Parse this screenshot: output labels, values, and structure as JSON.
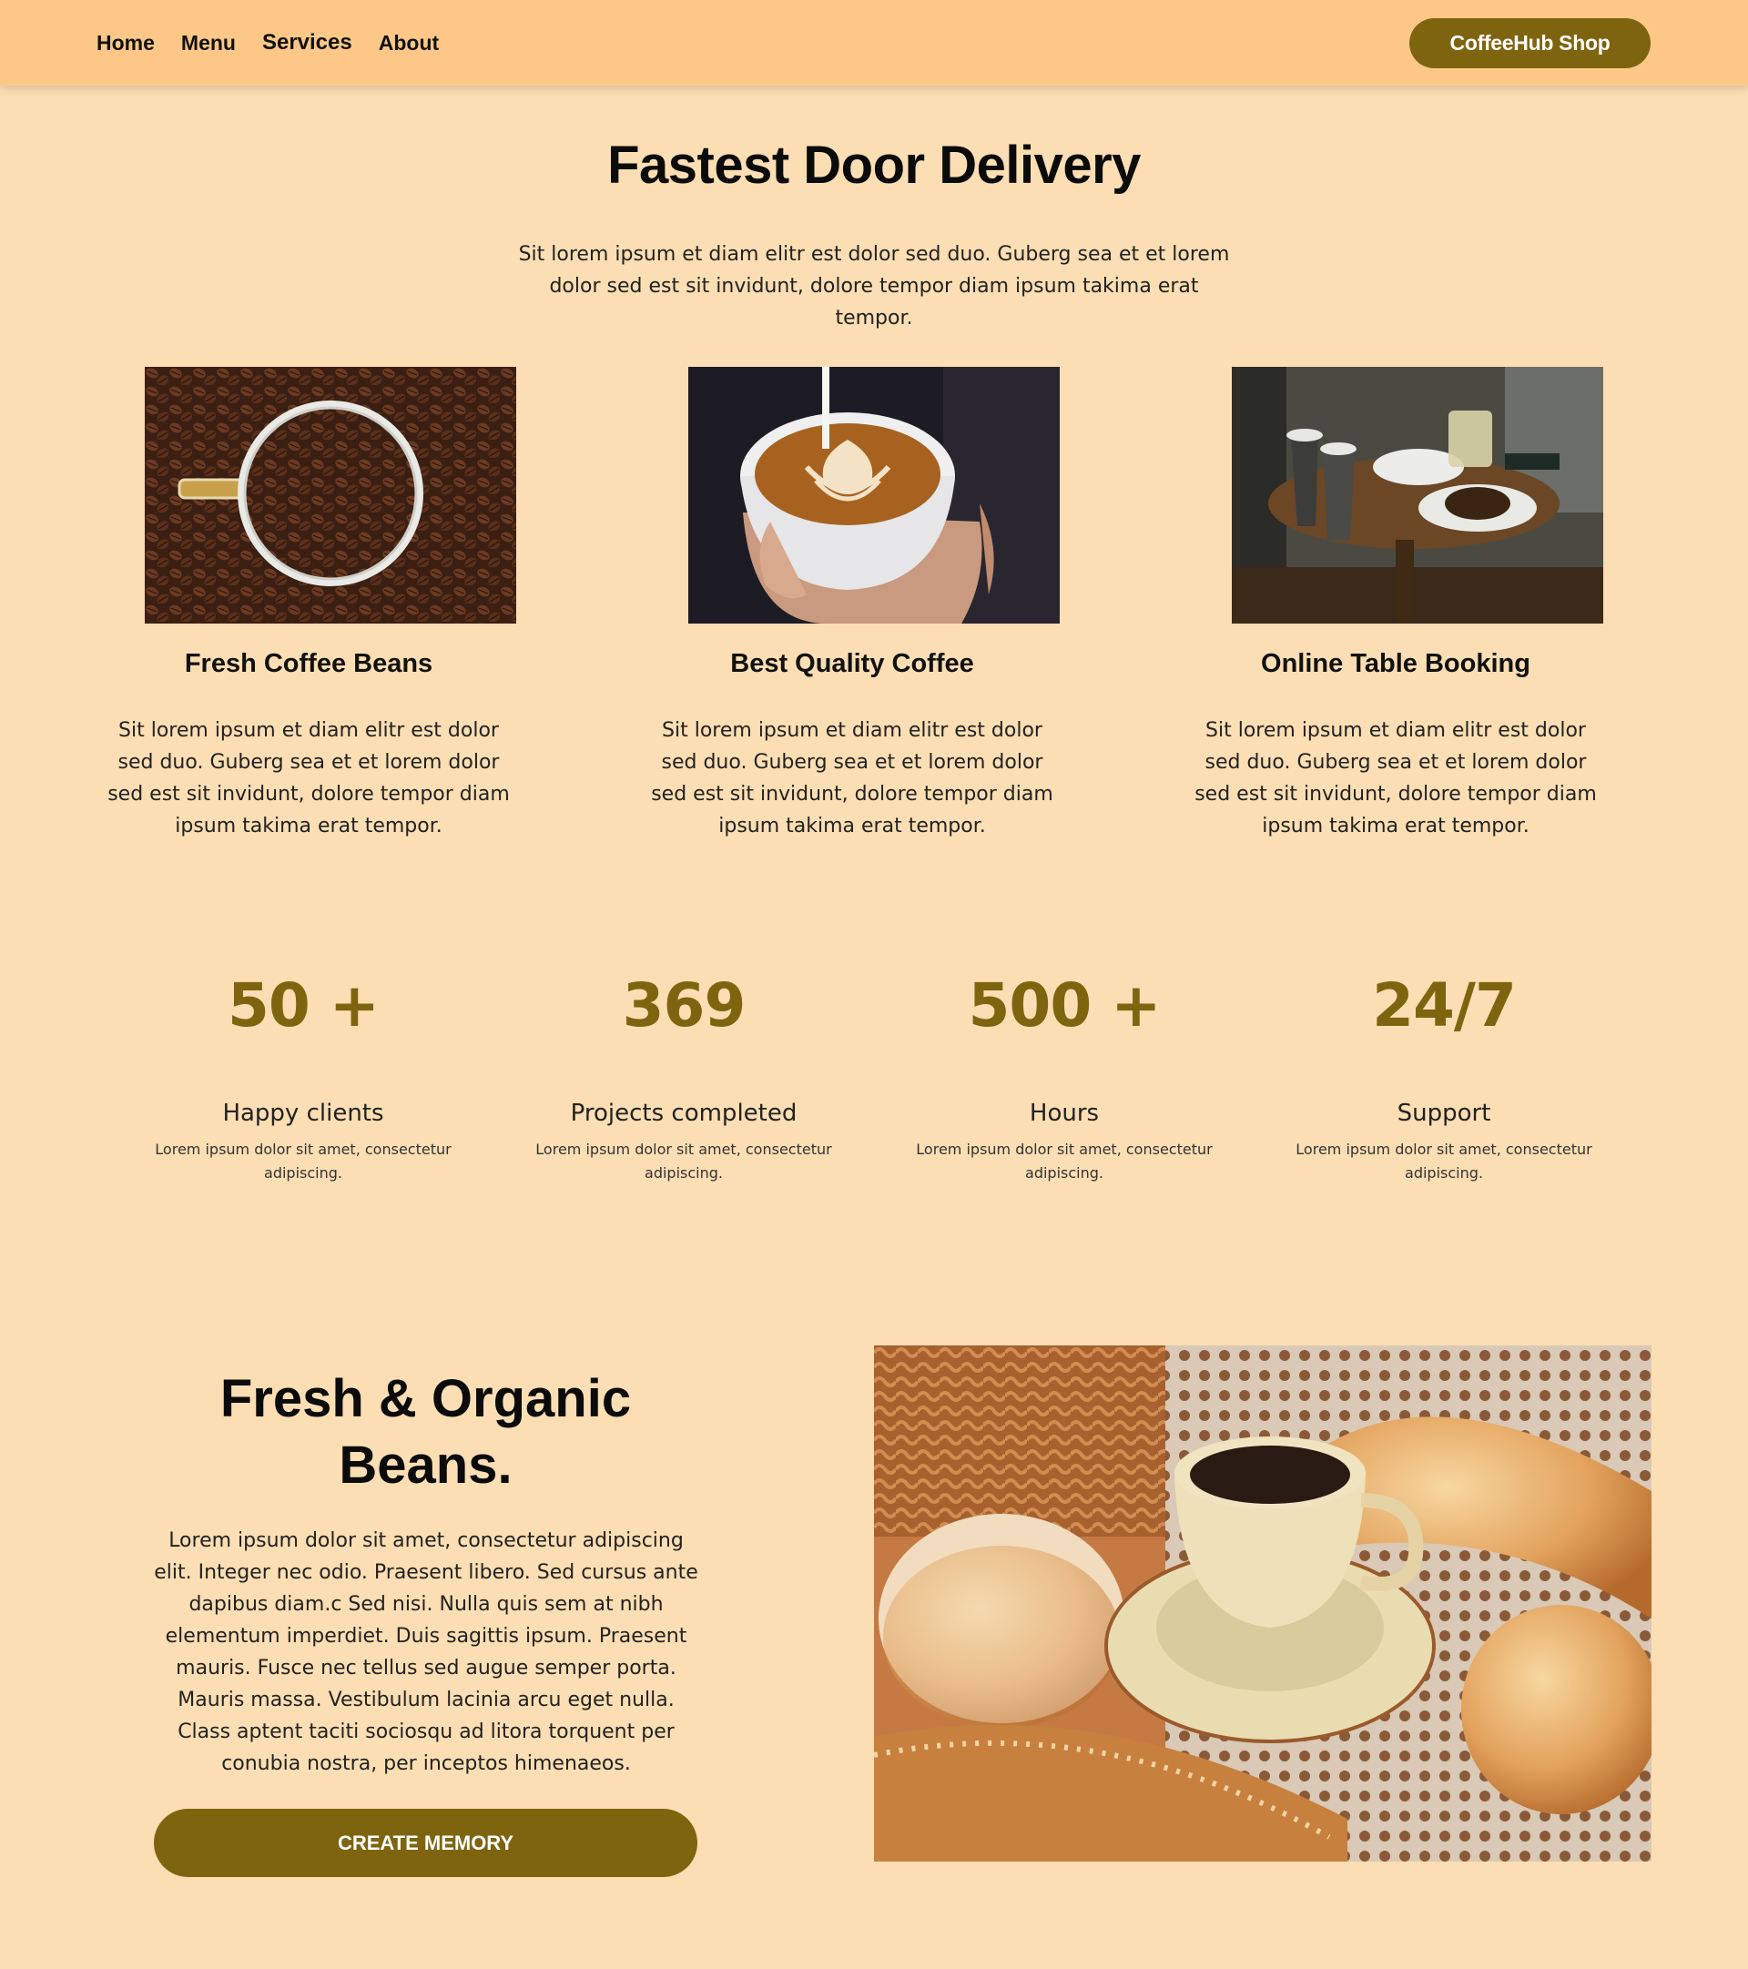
{
  "nav": {
    "links": [
      "Home",
      "Menu",
      "Services",
      "About"
    ],
    "shop_button": "CoffeeHub Shop"
  },
  "delivery": {
    "title": "Fastest Door Delivery",
    "subtitle": "Sit lorem ipsum et diam elitr est dolor sed duo. Guberg sea et et lorem dolor sed est sit invidunt, dolore tempor diam ipsum takima erat tempor.",
    "features": [
      {
        "title": "Fresh Coffee Beans",
        "text": "Sit lorem ipsum et diam elitr est dolor sed duo. Guberg sea et et lorem dolor sed est sit invidunt, dolore tempor diam ipsum takima erat tempor.",
        "image": "coffee-beans-cup-photo"
      },
      {
        "title": "Best Quality Coffee",
        "text": "Sit lorem ipsum et diam elitr est dolor sed duo. Guberg sea et et lorem dolor sed est sit invidunt, dolore tempor diam ipsum takima erat tempor.",
        "image": "latte-art-photo"
      },
      {
        "title": "Online Table Booking",
        "text": "Sit lorem ipsum et diam elitr est dolor sed duo. Guberg sea et et lorem dolor sed est sit invidunt, dolore tempor diam ipsum takima erat tempor.",
        "image": "cafe-table-photo"
      }
    ]
  },
  "stats": [
    {
      "value": "50 +",
      "label": "Happy clients",
      "desc": "Lorem ipsum dolor sit amet, consectetur adipiscing."
    },
    {
      "value": "369",
      "label": "Projects completed",
      "desc": "Lorem ipsum dolor sit amet, consectetur adipiscing."
    },
    {
      "value": "500 +",
      "label": "Hours",
      "desc": "Lorem ipsum dolor sit amet, consectetur adipiscing."
    },
    {
      "value": "24/7",
      "label": "Support",
      "desc": "Lorem ipsum dolor sit amet, consectetur adipiscing."
    }
  ],
  "organic": {
    "title_line1": "Fresh & Organic",
    "title_line2": "Beans.",
    "text": "Lorem ipsum dolor sit amet, consectetur adipiscing elit. Integer nec odio. Praesent libero. Sed cursus ante dapibus diam.c Sed nisi. Nulla quis sem at nibh elementum imperdiet. Duis sagittis ipsum. Praesent mauris. Fusce nec tellus sed augue semper porta. Mauris massa. Vestibulum lacinia arcu eget nulla. Class aptent taciti sociosqu ad litora torquent per conubia nostra, per inceptos himenaeos.",
    "button": "CREATE MEMORY",
    "image": "coffee-and-bread-photo"
  },
  "colors": {
    "page_bg": "#fbdeb3",
    "nav_bg": "#fdc887",
    "accent": "#7f6410"
  }
}
